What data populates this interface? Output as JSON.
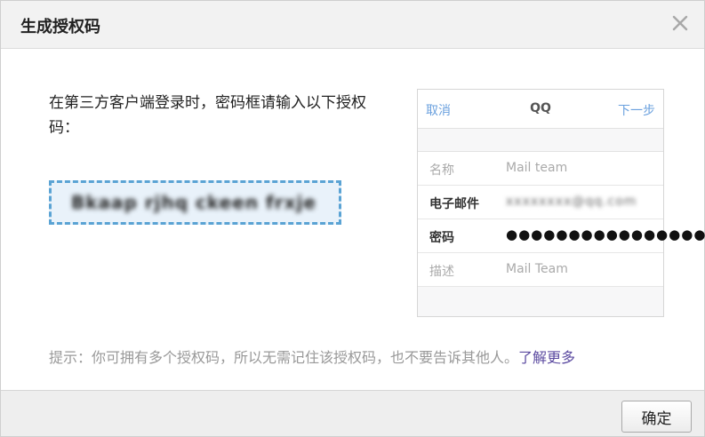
{
  "dialog": {
    "title": "生成授权码",
    "close_icon": "close-icon",
    "confirm_label": "确定"
  },
  "instruction": "在第三方客户端登录时，密码框请输入以下授权码：",
  "auth_code": "Bkaap rjhq ckeen frxje",
  "phone_preview": {
    "nav": {
      "cancel": "取消",
      "title": "QQ",
      "next": "下一步"
    },
    "rows": [
      {
        "label": "名称",
        "value": "Mail team"
      },
      {
        "label": "电子邮件",
        "value": "xxxxxxxx@qq.com"
      },
      {
        "label": "密码",
        "value": "●●●●●●●●●●●●●●●●"
      },
      {
        "label": "描述",
        "value": "Mail Team"
      }
    ]
  },
  "tip": {
    "text": "提示：你可拥有多个授权码，所以无需记住该授权码，也不要告诉其他人。",
    "link": "了解更多"
  },
  "colors": {
    "accent_link": "#5b4aa0",
    "code_border": "#5aa3d4",
    "code_background": "#e9f2fa",
    "ios_blue": "#6aa0de"
  }
}
